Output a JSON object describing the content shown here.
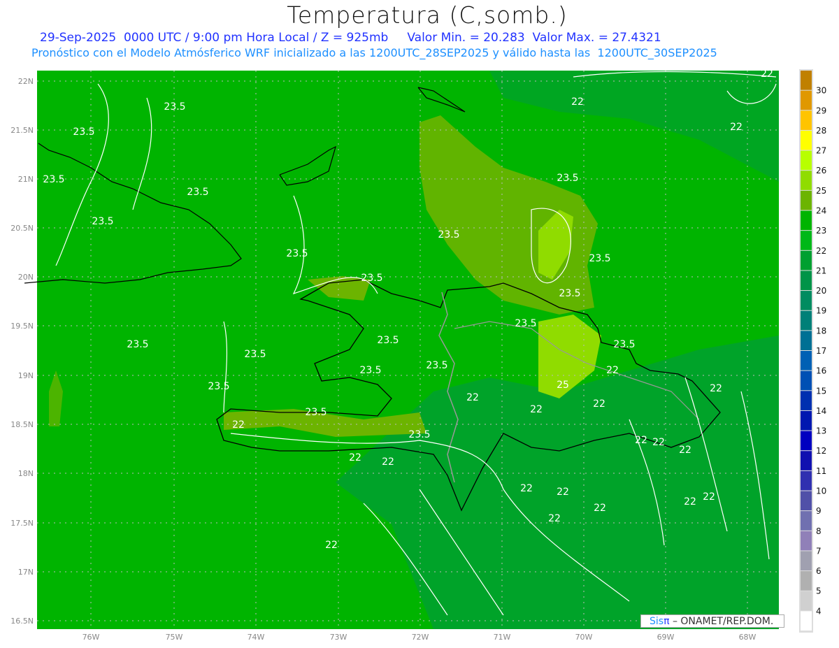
{
  "title": "Temperatura (C,somb.)",
  "subtitle1": "29-Sep-2025  0000 UTC / 9:00 pm Hora Local / Z = 925mb     Valor Min. = 20.283  Valor Max. = 27.4321",
  "subtitle2": "Pronóstico con el Modelo Atmósferico WRF inicializado a las 1200UTC_28SEP2025 y válido hasta las  1200UTC_30SEP2025",
  "lat_labels": [
    "22N",
    "21.5N",
    "21N",
    "20.5N",
    "20N",
    "19.5N",
    "19N",
    "18.5N",
    "18N",
    "17.5N",
    "17N",
    "16.5N"
  ],
  "lon_labels": [
    "76W",
    "75W",
    "74W",
    "73W",
    "72W",
    "71W",
    "70W",
    "69W",
    "68W"
  ],
  "colorbar": {
    "labels": [
      "30",
      "29",
      "28",
      "27",
      "26",
      "25",
      "24",
      "23",
      "22",
      "21",
      "20",
      "19",
      "18",
      "17",
      "16",
      "15",
      "14",
      "13",
      "12",
      "11",
      "10",
      "9",
      "8",
      "7",
      "6",
      "5",
      "4"
    ],
    "colors": [
      "#c08000",
      "#e09800",
      "#ffc400",
      "#ffff00",
      "#b8ff00",
      "#90dc00",
      "#6cb400",
      "#00b400",
      "#00b818",
      "#00a030",
      "#009448",
      "#008c60",
      "#008078",
      "#007094",
      "#0060b4",
      "#0050b4",
      "#0030b0",
      "#0018b0",
      "#0000c0",
      "#1010b0",
      "#3030b0",
      "#5050a8",
      "#7070b0",
      "#9080b8",
      "#a0a0b0",
      "#b0b0b0",
      "#d0d0d0",
      "#ffffff"
    ]
  },
  "contour_labels": [
    "23.5",
    "23.5",
    "23.5",
    "23.5",
    "23.5",
    "23.5",
    "23.5",
    "23.5",
    "23.5",
    "23.5",
    "23.5",
    "23.5",
    "23.5",
    "23.5",
    "23.5",
    "23.5",
    "23.5",
    "23.5",
    "23.5",
    "23.5",
    "23.5",
    "25",
    "22",
    "22",
    "22",
    "22",
    "22",
    "22",
    "22",
    "22",
    "22",
    "22",
    "22",
    "22",
    "22",
    "22",
    "22",
    "22",
    "22",
    "22",
    "22",
    "22",
    "22"
  ],
  "watermark": {
    "brand_a": "Sis",
    "brand_b": "π",
    "text": " –  ONAMET/REP.DOM."
  }
}
